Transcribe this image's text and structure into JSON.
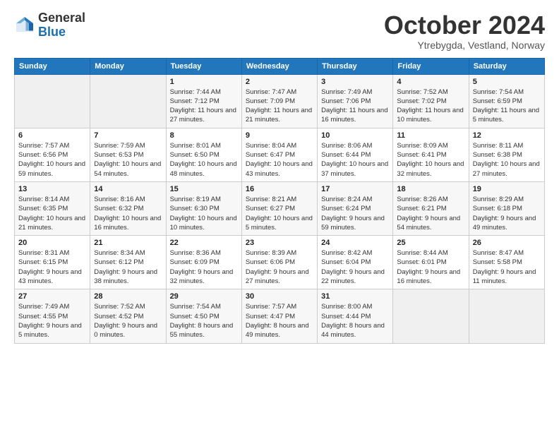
{
  "logo": {
    "general": "General",
    "blue": "Blue"
  },
  "header": {
    "month": "October 2024",
    "location": "Ytrebygda, Vestland, Norway"
  },
  "weekdays": [
    "Sunday",
    "Monday",
    "Tuesday",
    "Wednesday",
    "Thursday",
    "Friday",
    "Saturday"
  ],
  "weeks": [
    [
      {
        "day": "",
        "info": ""
      },
      {
        "day": "",
        "info": ""
      },
      {
        "day": "1",
        "info": "Sunrise: 7:44 AM\nSunset: 7:12 PM\nDaylight: 11 hours and 27 minutes."
      },
      {
        "day": "2",
        "info": "Sunrise: 7:47 AM\nSunset: 7:09 PM\nDaylight: 11 hours and 21 minutes."
      },
      {
        "day": "3",
        "info": "Sunrise: 7:49 AM\nSunset: 7:06 PM\nDaylight: 11 hours and 16 minutes."
      },
      {
        "day": "4",
        "info": "Sunrise: 7:52 AM\nSunset: 7:02 PM\nDaylight: 11 hours and 10 minutes."
      },
      {
        "day": "5",
        "info": "Sunrise: 7:54 AM\nSunset: 6:59 PM\nDaylight: 11 hours and 5 minutes."
      }
    ],
    [
      {
        "day": "6",
        "info": "Sunrise: 7:57 AM\nSunset: 6:56 PM\nDaylight: 10 hours and 59 minutes."
      },
      {
        "day": "7",
        "info": "Sunrise: 7:59 AM\nSunset: 6:53 PM\nDaylight: 10 hours and 54 minutes."
      },
      {
        "day": "8",
        "info": "Sunrise: 8:01 AM\nSunset: 6:50 PM\nDaylight: 10 hours and 48 minutes."
      },
      {
        "day": "9",
        "info": "Sunrise: 8:04 AM\nSunset: 6:47 PM\nDaylight: 10 hours and 43 minutes."
      },
      {
        "day": "10",
        "info": "Sunrise: 8:06 AM\nSunset: 6:44 PM\nDaylight: 10 hours and 37 minutes."
      },
      {
        "day": "11",
        "info": "Sunrise: 8:09 AM\nSunset: 6:41 PM\nDaylight: 10 hours and 32 minutes."
      },
      {
        "day": "12",
        "info": "Sunrise: 8:11 AM\nSunset: 6:38 PM\nDaylight: 10 hours and 27 minutes."
      }
    ],
    [
      {
        "day": "13",
        "info": "Sunrise: 8:14 AM\nSunset: 6:35 PM\nDaylight: 10 hours and 21 minutes."
      },
      {
        "day": "14",
        "info": "Sunrise: 8:16 AM\nSunset: 6:32 PM\nDaylight: 10 hours and 16 minutes."
      },
      {
        "day": "15",
        "info": "Sunrise: 8:19 AM\nSunset: 6:30 PM\nDaylight: 10 hours and 10 minutes."
      },
      {
        "day": "16",
        "info": "Sunrise: 8:21 AM\nSunset: 6:27 PM\nDaylight: 10 hours and 5 minutes."
      },
      {
        "day": "17",
        "info": "Sunrise: 8:24 AM\nSunset: 6:24 PM\nDaylight: 9 hours and 59 minutes."
      },
      {
        "day": "18",
        "info": "Sunrise: 8:26 AM\nSunset: 6:21 PM\nDaylight: 9 hours and 54 minutes."
      },
      {
        "day": "19",
        "info": "Sunrise: 8:29 AM\nSunset: 6:18 PM\nDaylight: 9 hours and 49 minutes."
      }
    ],
    [
      {
        "day": "20",
        "info": "Sunrise: 8:31 AM\nSunset: 6:15 PM\nDaylight: 9 hours and 43 minutes."
      },
      {
        "day": "21",
        "info": "Sunrise: 8:34 AM\nSunset: 6:12 PM\nDaylight: 9 hours and 38 minutes."
      },
      {
        "day": "22",
        "info": "Sunrise: 8:36 AM\nSunset: 6:09 PM\nDaylight: 9 hours and 32 minutes."
      },
      {
        "day": "23",
        "info": "Sunrise: 8:39 AM\nSunset: 6:06 PM\nDaylight: 9 hours and 27 minutes."
      },
      {
        "day": "24",
        "info": "Sunrise: 8:42 AM\nSunset: 6:04 PM\nDaylight: 9 hours and 22 minutes."
      },
      {
        "day": "25",
        "info": "Sunrise: 8:44 AM\nSunset: 6:01 PM\nDaylight: 9 hours and 16 minutes."
      },
      {
        "day": "26",
        "info": "Sunrise: 8:47 AM\nSunset: 5:58 PM\nDaylight: 9 hours and 11 minutes."
      }
    ],
    [
      {
        "day": "27",
        "info": "Sunrise: 7:49 AM\nSunset: 4:55 PM\nDaylight: 9 hours and 5 minutes."
      },
      {
        "day": "28",
        "info": "Sunrise: 7:52 AM\nSunset: 4:52 PM\nDaylight: 9 hours and 0 minutes."
      },
      {
        "day": "29",
        "info": "Sunrise: 7:54 AM\nSunset: 4:50 PM\nDaylight: 8 hours and 55 minutes."
      },
      {
        "day": "30",
        "info": "Sunrise: 7:57 AM\nSunset: 4:47 PM\nDaylight: 8 hours and 49 minutes."
      },
      {
        "day": "31",
        "info": "Sunrise: 8:00 AM\nSunset: 4:44 PM\nDaylight: 8 hours and 44 minutes."
      },
      {
        "day": "",
        "info": ""
      },
      {
        "day": "",
        "info": ""
      }
    ]
  ]
}
